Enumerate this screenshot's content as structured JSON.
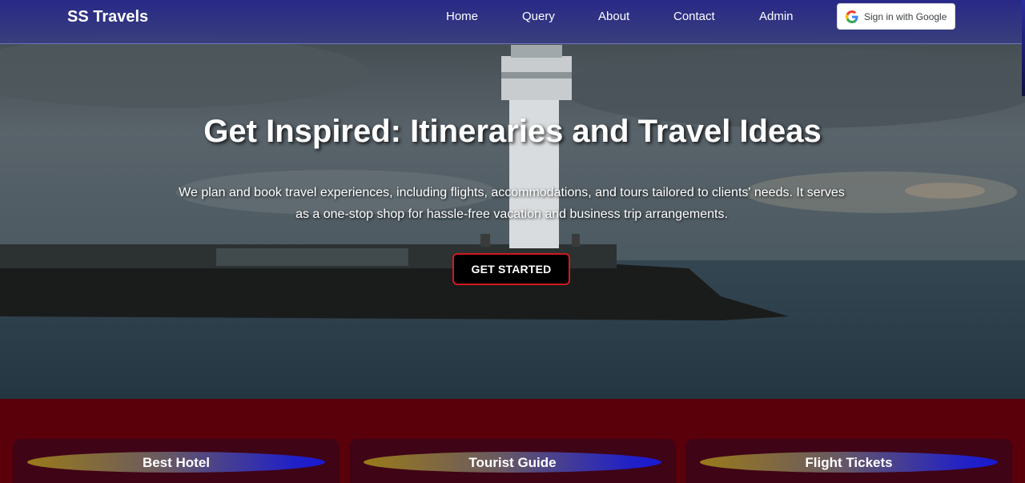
{
  "navbar": {
    "brand": "SS Travels",
    "links": [
      {
        "label": "Home"
      },
      {
        "label": "Query"
      },
      {
        "label": "About"
      },
      {
        "label": "Contact"
      },
      {
        "label": "Admin"
      }
    ],
    "google_signin_label": "Sign in with Google",
    "background_color": "#2a2c8c"
  },
  "hero": {
    "title": "Get Inspired: Itineraries and Travel Ideas",
    "description": "We plan and book travel experiences, including flights, accommodations, and tours tailored to clients' needs. It serves as a one-stop shop for hassle-free vacation and business trip arrangements.",
    "cta_label": "GET STARTED",
    "cta_border_color": "#d01a20"
  },
  "services": {
    "background_color": "#5a000a",
    "cards": [
      {
        "title": "Best Hotel"
      },
      {
        "title": "Tourist Guide"
      },
      {
        "title": "Flight Tickets"
      }
    ]
  }
}
